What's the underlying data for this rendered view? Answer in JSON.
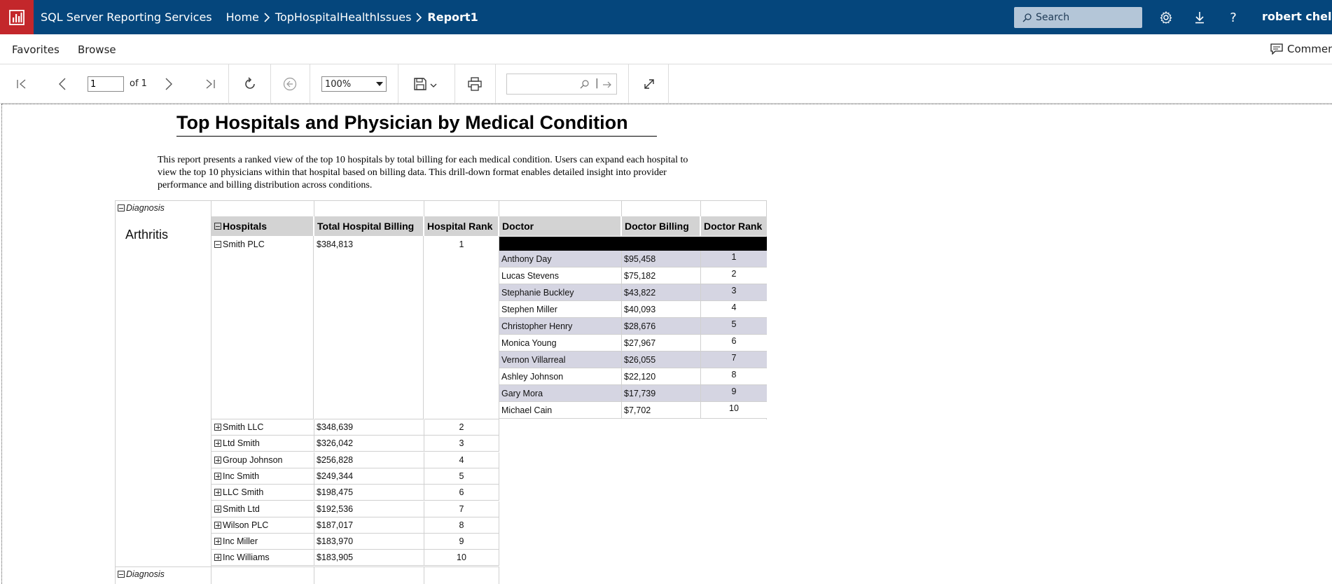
{
  "header": {
    "app_title": "SQL Server Reporting Services",
    "breadcrumbs": [
      "Home",
      "TopHospitalHealthIssues",
      "Report1"
    ],
    "search_placeholder": "Search",
    "user_name": "robert chelala"
  },
  "nav": {
    "favorites": "Favorites",
    "browse": "Browse",
    "comments": "Comments"
  },
  "toolbar": {
    "page_number": "1",
    "page_of": "of 1",
    "zoom": "100%"
  },
  "report": {
    "title": "Top Hospitals and Physician by Medical Condition",
    "description": "This report presents a ranked view of the top 10 hospitals by total billing for each medical condition. Users can expand each hospital to view the top 10 physicians within that hospital based on billing data. This drill-down format enables detailed insight into provider performance and billing distribution across conditions.",
    "diagnosis_label": "Diagnosis",
    "condition": "Arthritis",
    "columns": {
      "hospitals": "Hospitals",
      "total_billing": "Total Hospital Billing",
      "hospital_rank": "Hospital Rank",
      "doctor": "Doctor",
      "doctor_billing": "Doctor Billing",
      "doctor_rank": "Doctor Rank"
    },
    "expanded_hospital": {
      "name": "Smith PLC",
      "billing": "$384,813",
      "rank": "1"
    },
    "doctors": [
      {
        "name": "Anthony Day",
        "billing": "$95,458",
        "rank": "1"
      },
      {
        "name": "Lucas Stevens",
        "billing": "$75,182",
        "rank": "2"
      },
      {
        "name": "Stephanie Buckley",
        "billing": "$43,822",
        "rank": "3"
      },
      {
        "name": "Stephen Miller",
        "billing": "$40,093",
        "rank": "4"
      },
      {
        "name": "Christopher Henry",
        "billing": "$28,676",
        "rank": "5"
      },
      {
        "name": "Monica Young",
        "billing": "$27,967",
        "rank": "6"
      },
      {
        "name": "Vernon Villarreal",
        "billing": "$26,055",
        "rank": "7"
      },
      {
        "name": "Ashley Johnson",
        "billing": "$22,120",
        "rank": "8"
      },
      {
        "name": "Gary Mora",
        "billing": "$17,739",
        "rank": "9"
      },
      {
        "name": "Michael Cain",
        "billing": "$7,702",
        "rank": "10"
      }
    ],
    "hospitals": [
      {
        "name": "Smith LLC",
        "billing": "$348,639",
        "rank": "2"
      },
      {
        "name": "Ltd Smith",
        "billing": "$326,042",
        "rank": "3"
      },
      {
        "name": "Group Johnson",
        "billing": "$256,828",
        "rank": "4"
      },
      {
        "name": "Inc Smith",
        "billing": "$249,344",
        "rank": "5"
      },
      {
        "name": "LLC Smith",
        "billing": "$198,475",
        "rank": "6"
      },
      {
        "name": "Smith Ltd",
        "billing": "$192,536",
        "rank": "7"
      },
      {
        "name": "Wilson PLC",
        "billing": "$187,017",
        "rank": "8"
      },
      {
        "name": "Inc Miller",
        "billing": "$183,970",
        "rank": "9"
      },
      {
        "name": "Inc Williams",
        "billing": "$183,905",
        "rank": "10"
      }
    ]
  },
  "colors": {
    "header_bg": "#05467c",
    "logo_bg": "#c3272b",
    "column_header_bg": "#d3d3d3",
    "doctor_row_alt": "#d5d5e2",
    "black_bar": "#000000"
  }
}
